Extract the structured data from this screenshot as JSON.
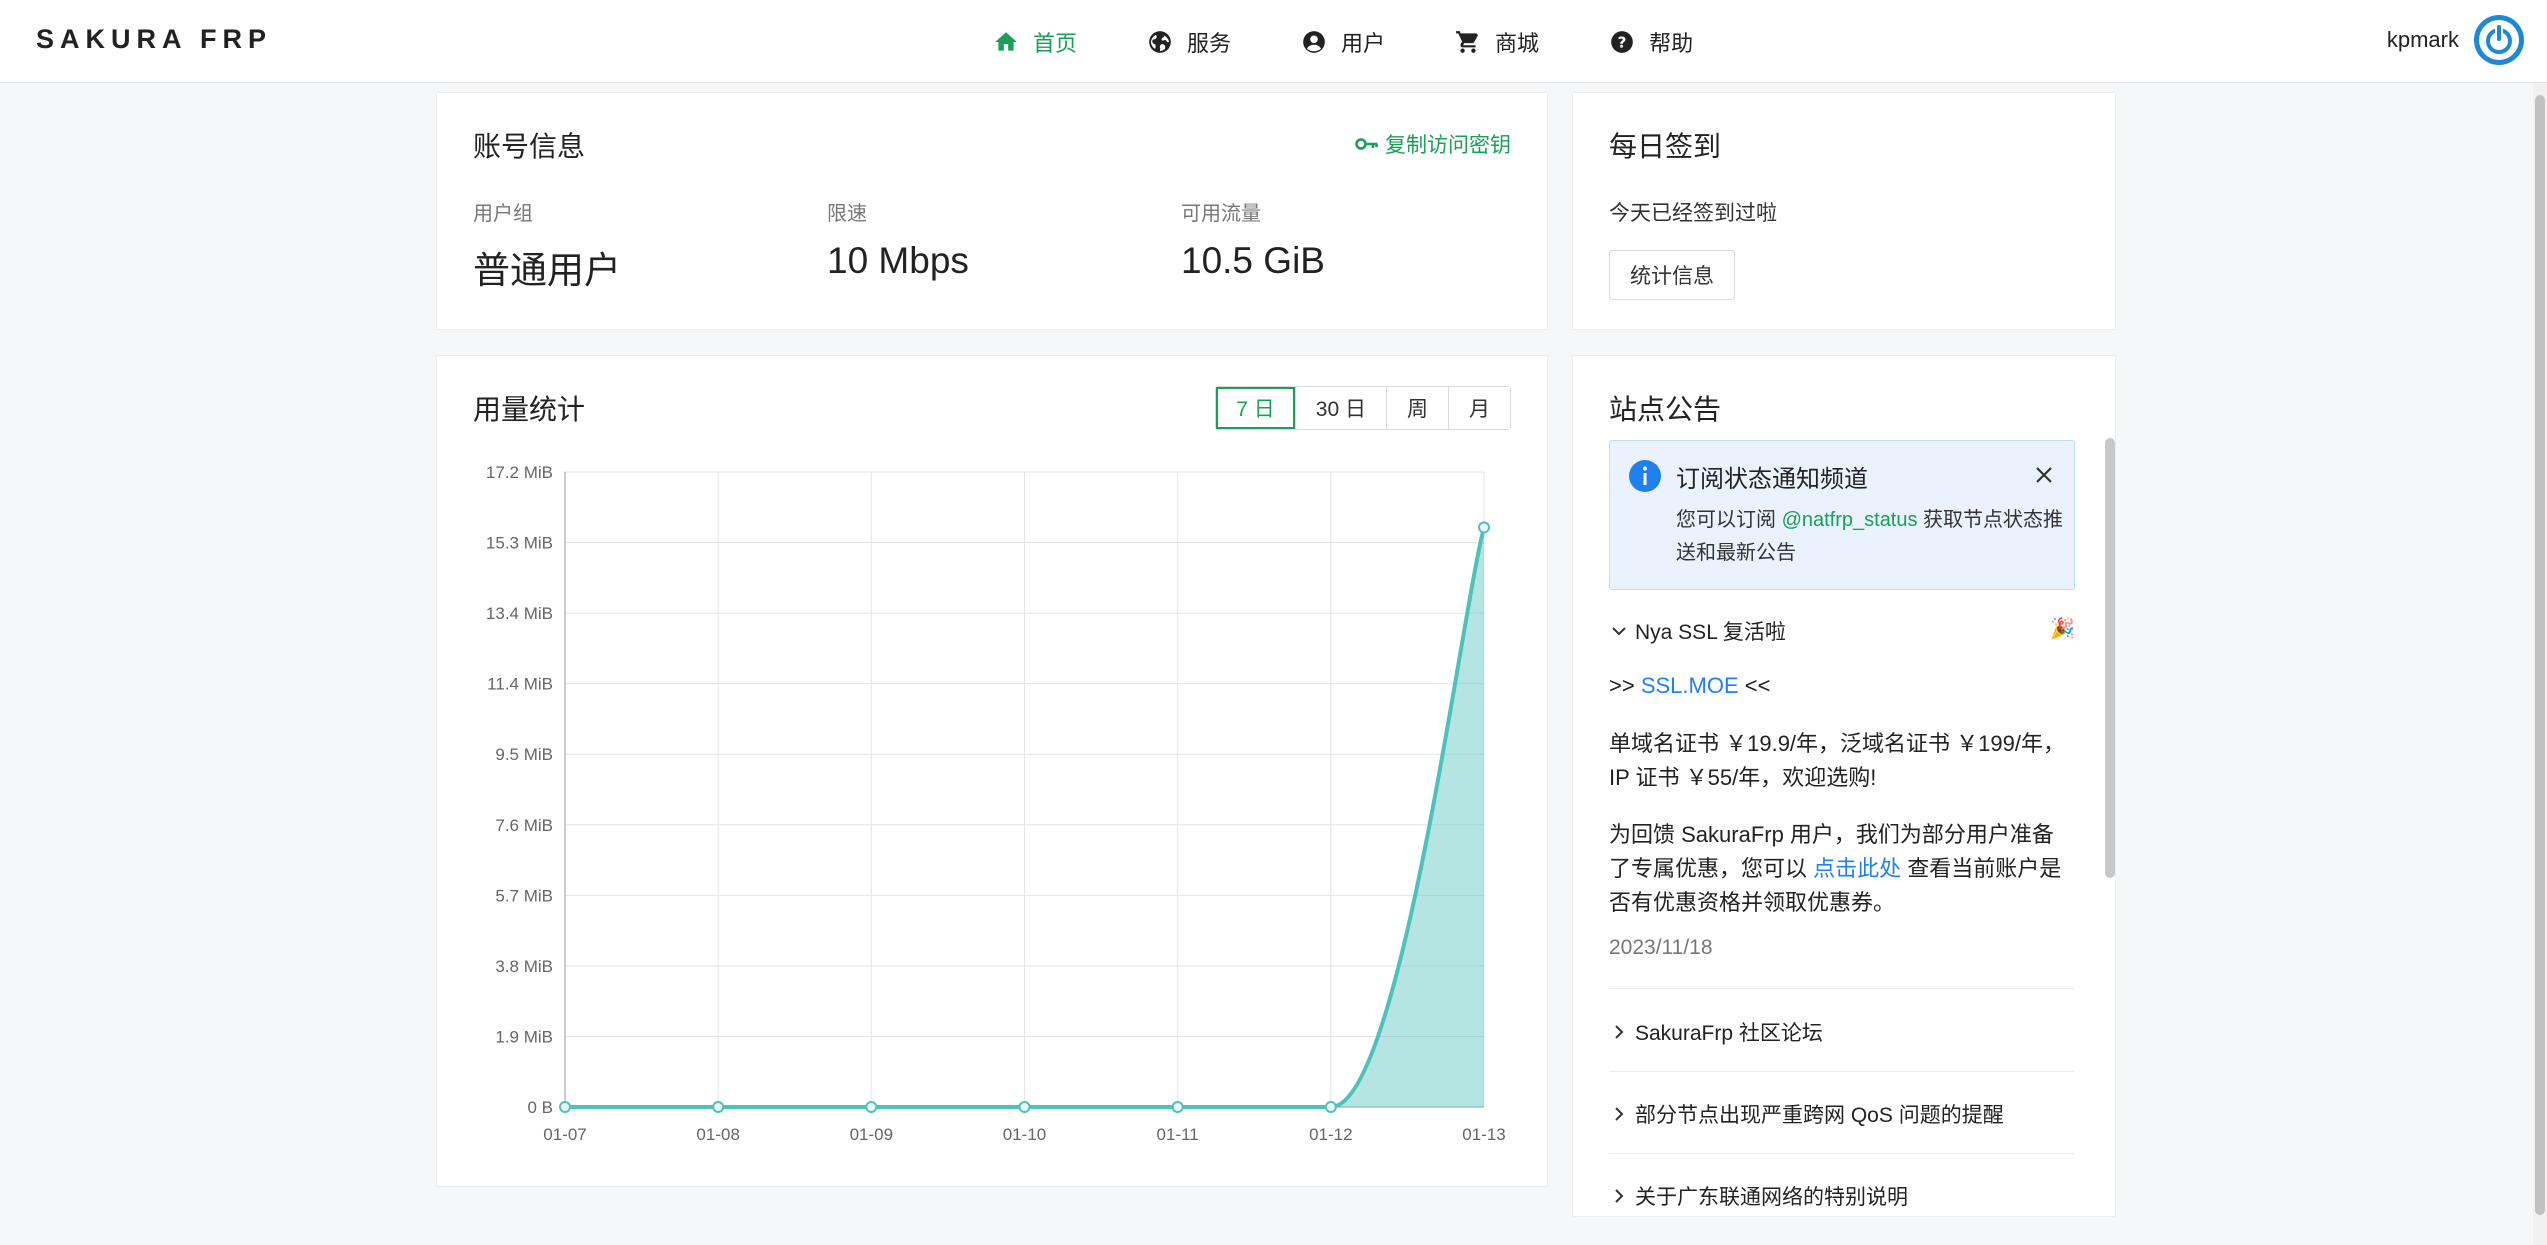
{
  "brand": "SAKURA FRP",
  "nav": [
    {
      "label": "首页",
      "icon": "home-icon",
      "active": true
    },
    {
      "label": "服务",
      "icon": "globe-icon",
      "active": false
    },
    {
      "label": "用户",
      "icon": "user-circle-icon",
      "active": false
    },
    {
      "label": "商城",
      "icon": "cart-icon",
      "active": false
    },
    {
      "label": "帮助",
      "icon": "help-icon",
      "active": false
    }
  ],
  "user": {
    "name": "kpmark",
    "avatar_icon": "power-avatar-icon"
  },
  "account": {
    "title": "账号信息",
    "copy_key": "复制访问密钥",
    "stats": [
      {
        "label": "用户组",
        "value": "普通用户"
      },
      {
        "label": "限速",
        "value": "10 Mbps"
      },
      {
        "label": "可用流量",
        "value": "10.5 GiB"
      }
    ]
  },
  "checkin": {
    "title": "每日签到",
    "message": "今天已经签到过啦",
    "button": "统计信息"
  },
  "usage": {
    "title": "用量统计",
    "ranges": [
      "7 日",
      "30 日",
      "周",
      "月"
    ],
    "active_range": 0
  },
  "chart_data": {
    "type": "area",
    "categories": [
      "01-07",
      "01-08",
      "01-09",
      "01-10",
      "01-11",
      "01-12",
      "01-13"
    ],
    "values": [
      0,
      0,
      0,
      0,
      0,
      0,
      15.7
    ],
    "y_ticks": [
      "0 B",
      "1.9 MiB",
      "3.8 MiB",
      "5.7 MiB",
      "7.6 MiB",
      "9.5 MiB",
      "11.4 MiB",
      "13.4 MiB",
      "15.3 MiB",
      "17.2 MiB"
    ],
    "ylim": [
      0,
      17.2
    ],
    "unit": "MiB",
    "grid": true,
    "color": "#4fc1bd"
  },
  "notice": {
    "title": "站点公告",
    "alert": {
      "title": "订阅状态通知频道",
      "body_before": "您可以订阅 ",
      "handle": "@natfrp_status",
      "body_after": " 获取节点状态推送和最新公告"
    },
    "announcements": [
      {
        "title": "Nya SSL 复活啦",
        "expanded": true,
        "emoji": "🎉",
        "line1_prefix": ">> ",
        "line1_link": "SSL.MOE",
        "line1_suffix": " <<",
        "para1": "单域名证书 ￥19.9/年，泛域名证书 ￥199/年，IP 证书 ￥55/年，欢迎选购!",
        "para2_before": "为回馈 SakuraFrp 用户，我们为部分用户准备了专属优惠，您可以 ",
        "para2_link": "点击此处",
        "para2_after": " 查看当前账户是否有优惠资格并领取优惠券。",
        "date": "2023/11/18"
      },
      {
        "title": "SakuraFrp 社区论坛",
        "expanded": false
      },
      {
        "title": "部分节点出现严重跨网 QoS 问题的提醒",
        "expanded": false
      },
      {
        "title": "关于广东联通网络的特别说明",
        "expanded": false
      }
    ]
  }
}
